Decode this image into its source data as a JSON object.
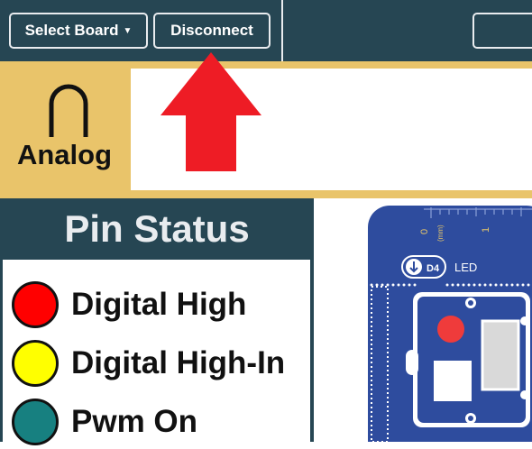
{
  "toolbar": {
    "select_board_label": "Select Board",
    "disconnect_label": "Disconnect",
    "right_button_label": ""
  },
  "mode": {
    "label": "Analog",
    "icon": "analog-symbol"
  },
  "message_panel": {
    "text": ""
  },
  "pin_status": {
    "title": "Pin Status",
    "legend": [
      {
        "label": "Digital High",
        "color": "#ff0000"
      },
      {
        "label": "Digital High-In",
        "color": "#ffff00"
      },
      {
        "label": "Pwm On",
        "color": "#178080"
      }
    ]
  },
  "board": {
    "ruler_zero": "0",
    "ruler_unit": "(mm)",
    "ruler_one": "1",
    "pin_label": "D4",
    "led_label": "LED"
  },
  "colors": {
    "toolbar": "#264653",
    "accent": "#e9c46a",
    "board": "#2e4c9e",
    "arrow": "#ee1c25"
  }
}
